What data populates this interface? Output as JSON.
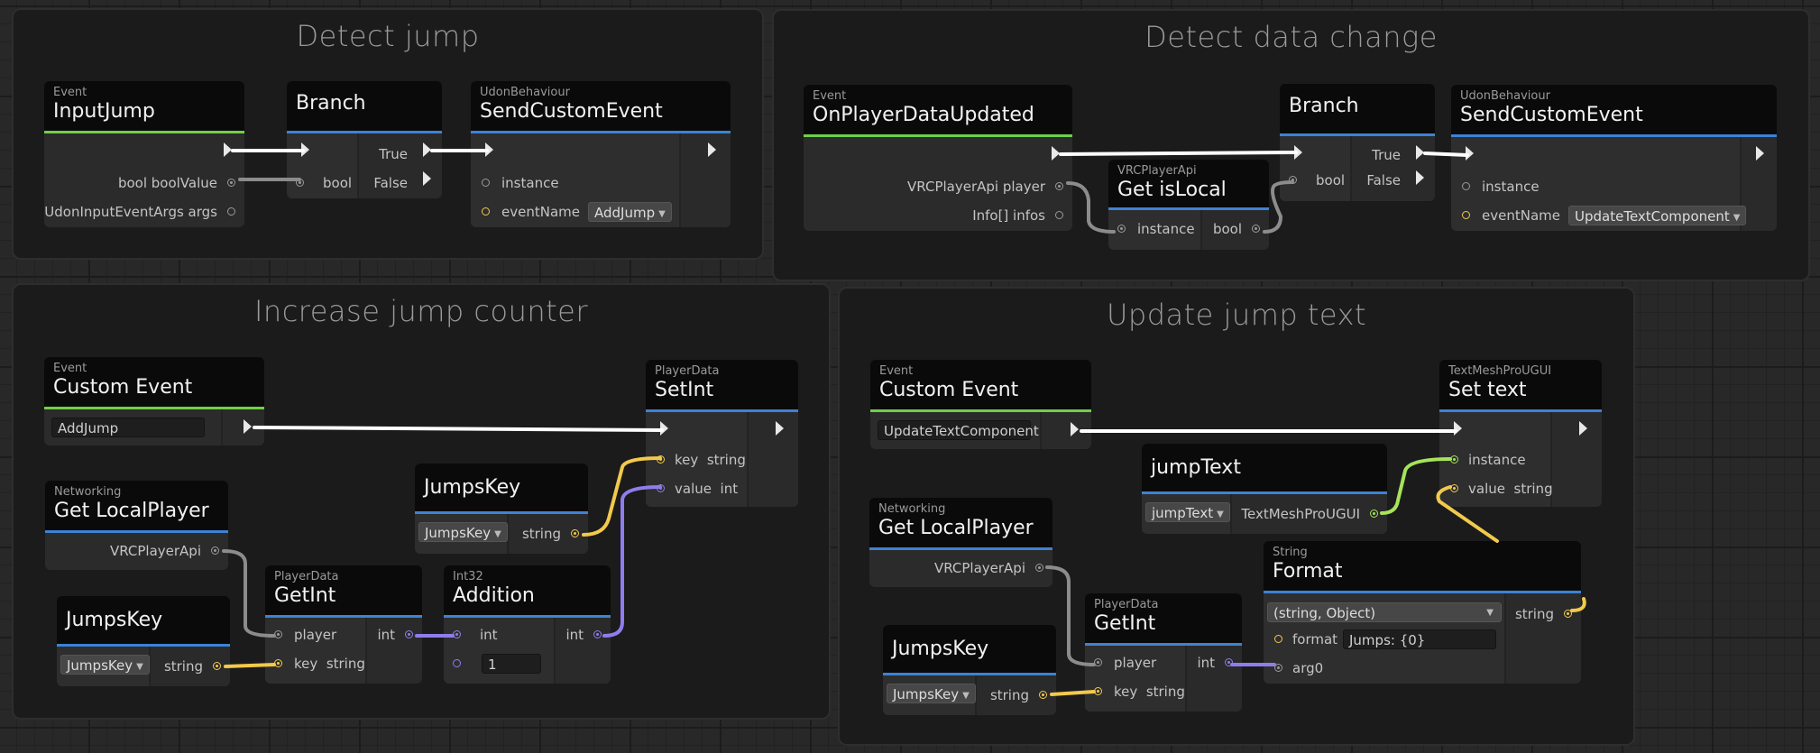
{
  "groups": {
    "detect_jump": {
      "title": "Detect jump",
      "input_jump": {
        "category": "Event",
        "title": "InputJump",
        "outputs": [
          "bool boolValue",
          "UdonInputEventArgs args"
        ]
      },
      "branch": {
        "title": "Branch",
        "input": "bool",
        "outputs": [
          "True",
          "False"
        ]
      },
      "send_custom_event": {
        "category": "UdonBehaviour",
        "title": "SendCustomEvent",
        "inputs": [
          "instance",
          "eventName"
        ],
        "event_name_value": "AddJump"
      }
    },
    "detect_data_change": {
      "title": "Detect data change",
      "on_player_data_updated": {
        "category": "Event",
        "title": "OnPlayerDataUpdated",
        "outputs": [
          "VRCPlayerApi player",
          "Info[] infos"
        ]
      },
      "get_is_local": {
        "category": "VRCPlayerApi",
        "title": "Get isLocal",
        "input": "instance",
        "output": "bool"
      },
      "branch": {
        "title": "Branch",
        "input": "bool",
        "outputs": [
          "True",
          "False"
        ]
      },
      "send_custom_event": {
        "category": "UdonBehaviour",
        "title": "SendCustomEvent",
        "inputs": [
          "instance",
          "eventName"
        ],
        "event_name_value": "UpdateTextComponent"
      }
    },
    "increase_jump_counter": {
      "title": "Increase jump counter",
      "custom_event": {
        "category": "Event",
        "title": "Custom Event",
        "name_value": "AddJump"
      },
      "set_int": {
        "category": "PlayerData",
        "title": "SetInt",
        "inputs": [
          {
            "name": "key",
            "type": "string"
          },
          {
            "name": "value",
            "type": "int"
          }
        ]
      },
      "jumps_key_top": {
        "title": "JumpsKey",
        "dropdown": "JumpsKey",
        "output": "string"
      },
      "get_local_player": {
        "category": "Networking",
        "title": "Get LocalPlayer",
        "output": "VRCPlayerApi"
      },
      "get_int": {
        "category": "PlayerData",
        "title": "GetInt",
        "inputs": [
          {
            "name": "player",
            "type": ""
          },
          {
            "name": "key",
            "type": "string"
          }
        ],
        "output": "int"
      },
      "addition": {
        "category": "Int32",
        "title": "Addition",
        "input": "int",
        "input2_value": "1",
        "output": "int"
      },
      "jumps_key_bottom": {
        "title": "JumpsKey",
        "dropdown": "JumpsKey",
        "output": "string"
      }
    },
    "update_jump_text": {
      "title": "Update jump text",
      "custom_event": {
        "category": "Event",
        "title": "Custom Event",
        "name_value": "UpdateTextComponent"
      },
      "set_text": {
        "category": "TextMeshProUGUI",
        "title": "Set text",
        "inputs": [
          {
            "name": "instance",
            "type": ""
          },
          {
            "name": "value",
            "type": "string"
          }
        ]
      },
      "jump_text": {
        "title": "jumpText",
        "dropdown": "jumpText",
        "output": "TextMeshProUGUI"
      },
      "get_local_player": {
        "category": "Networking",
        "title": "Get LocalPlayer",
        "output": "VRCPlayerApi"
      },
      "format": {
        "category": "String",
        "title": "Format",
        "overload": "(string, Object)",
        "format_label": "format",
        "format_value": "Jumps: {0}",
        "arg_label": "arg0",
        "output": "string"
      },
      "get_int": {
        "category": "PlayerData",
        "title": "GetInt",
        "inputs": [
          {
            "name": "player",
            "type": ""
          },
          {
            "name": "key",
            "type": "string"
          }
        ],
        "output": "int"
      },
      "jumps_key": {
        "title": "JumpsKey",
        "dropdown": "JumpsKey",
        "output": "string"
      }
    }
  },
  "colors": {
    "event_accent": "#6fd04a",
    "node_accent": "#3d82d6",
    "flow_wire": "#ffffff",
    "bool_wire": "#8c8c8c",
    "string_wire": "#f2c94c",
    "int_wire": "#8f7dee",
    "component_wire": "#a6e35a"
  }
}
